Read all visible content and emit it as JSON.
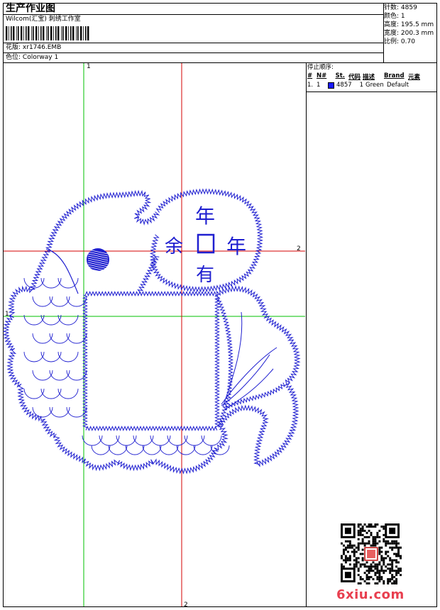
{
  "header": {
    "title": "生产作业图",
    "company": "Wilcom(汇宝) 刺绣工作室",
    "design_label": "花版:",
    "design_file": "xr1746.EMB",
    "colorway_label": "色位:",
    "colorway": "Colorway 1"
  },
  "stats": [
    {
      "label": "针数:",
      "value": "4859"
    },
    {
      "label": "颜色:",
      "value": "1"
    },
    {
      "label": "高度:",
      "value": "195.5 mm"
    },
    {
      "label": "宽度:",
      "value": "200.3 mm"
    },
    {
      "label": "比例:",
      "value": "0.70"
    }
  ],
  "stop_sequence": {
    "title": "停止顺序:",
    "columns": [
      "#",
      "N#",
      "St.",
      "代码",
      "描述",
      "Brand",
      "元素"
    ],
    "rows": [
      {
        "index": "1.",
        "needle": "1",
        "color": "#1a1aff",
        "stitches": "4857",
        "code": "1",
        "description": "Green",
        "brand": "Default",
        "element": ""
      }
    ]
  },
  "guides": {
    "green_v_label": "1",
    "green_h_label": "1",
    "red_h_label": "2",
    "red_v_label": "2",
    "green_color": "#00c000",
    "red_color": "#d40000"
  },
  "design": {
    "stitch_color": "#1f1fd0",
    "characters": {
      "top": "年",
      "left": "余",
      "right": "年",
      "bottom": "有"
    }
  },
  "watermark": {
    "text": "6xiu.com",
    "color": "#e83f4f"
  }
}
